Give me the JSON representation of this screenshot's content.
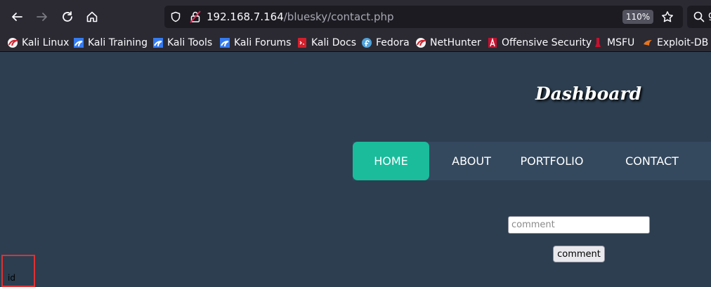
{
  "browser": {
    "url_host": "192.168.7.164",
    "url_path": "/bluesky/contact.php",
    "zoom": "110%",
    "search_partial": "g"
  },
  "bookmarks": [
    {
      "label": "Kali Linux",
      "icon": "kali-dragon-icon"
    },
    {
      "label": "Kali Training",
      "icon": "kali-training-icon"
    },
    {
      "label": "Kali Tools",
      "icon": "kali-tools-icon"
    },
    {
      "label": "Kali Forums",
      "icon": "kali-forums-icon"
    },
    {
      "label": "Kali Docs",
      "icon": "kali-docs-icon"
    },
    {
      "label": "Fedora",
      "icon": "fedora-icon"
    },
    {
      "label": "NetHunter",
      "icon": "nethunter-icon"
    },
    {
      "label": "Offensive Security",
      "icon": "offsec-icon"
    },
    {
      "label": "MSFU",
      "icon": "msfu-icon"
    },
    {
      "label": "Exploit-DB",
      "icon": "exploitdb-icon"
    }
  ],
  "page": {
    "brand": "Dashboard",
    "nav": [
      {
        "label": "HOME",
        "active": true
      },
      {
        "label": "ABOUT",
        "active": false
      },
      {
        "label": "PORTFOLIO",
        "active": false
      },
      {
        "label": "CONTACT",
        "active": false
      }
    ],
    "comment_placeholder": "comment",
    "comment_button": "comment",
    "id_label": "id"
  },
  "colors": {
    "page_bg": "#2c3e50",
    "navbar_bg": "#34495e",
    "active_nav": "#1abc9c",
    "highlight_box": "#e03131"
  }
}
